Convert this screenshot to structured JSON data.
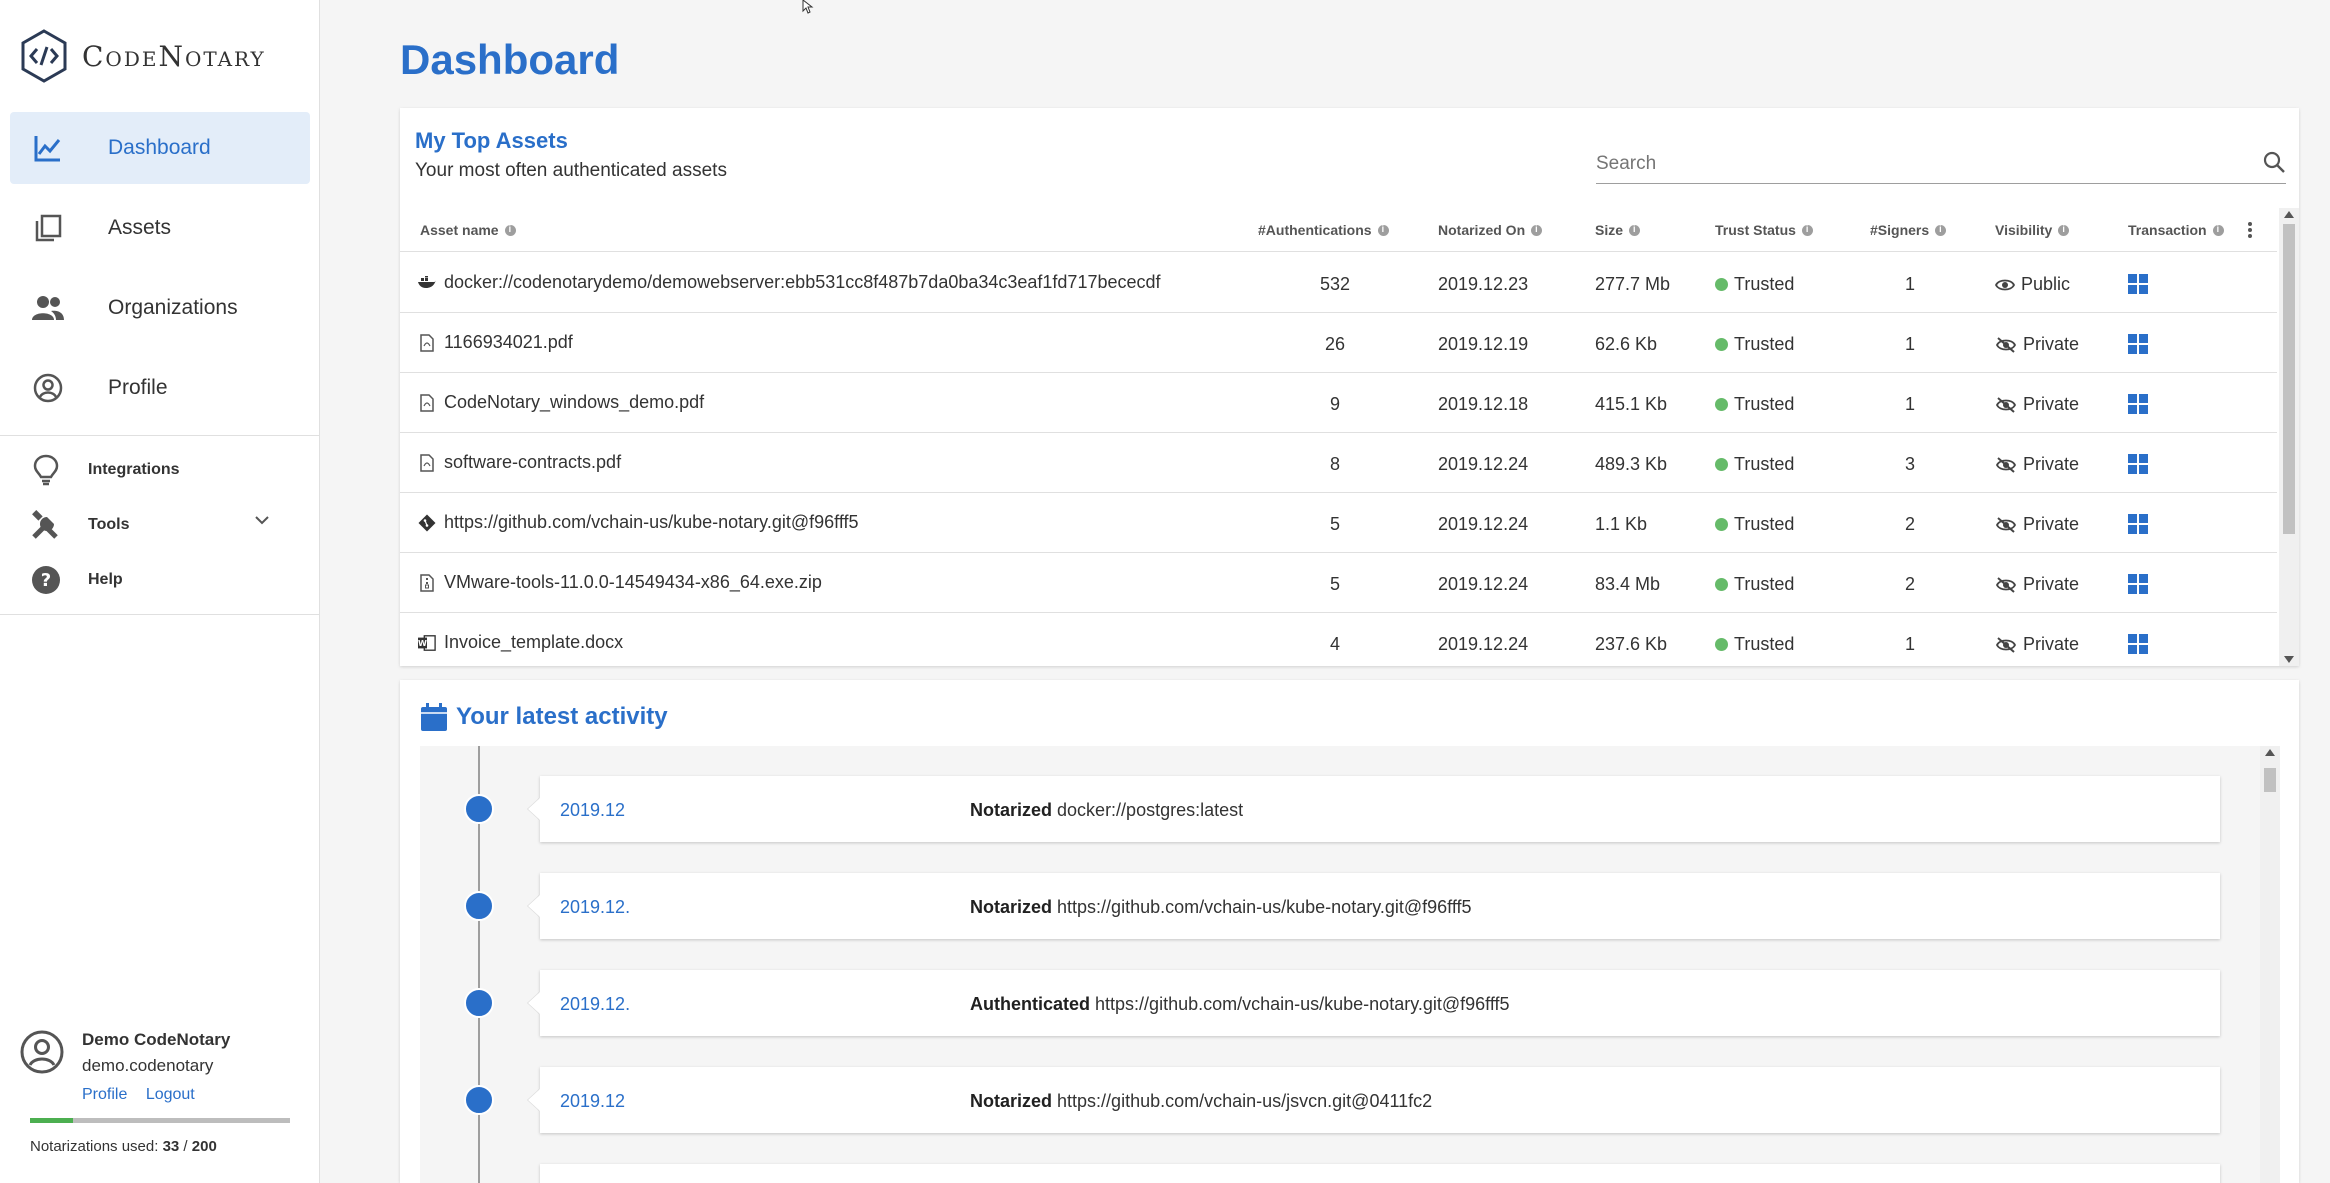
{
  "brand": {
    "name": "CodeNotary"
  },
  "nav": {
    "main": [
      {
        "label": "Dashboard",
        "icon": "chart-line-icon",
        "active": true
      },
      {
        "label": "Assets",
        "icon": "copy-icon",
        "active": false
      },
      {
        "label": "Organizations",
        "icon": "people-icon",
        "active": false
      },
      {
        "label": "Profile",
        "icon": "account-circle-icon",
        "active": false
      }
    ],
    "secondary": [
      {
        "label": "Integrations",
        "icon": "lightbulb-icon"
      },
      {
        "label": "Tools",
        "icon": "tools-icon"
      },
      {
        "label": "Help",
        "icon": "help-circle-icon"
      }
    ]
  },
  "user": {
    "name": "Demo CodeNotary",
    "handle": "demo.codenotary",
    "profile_link": "Profile",
    "logout_link": "Logout",
    "quota_label": "Notarizations used:",
    "quota_used": "33",
    "quota_total": "200",
    "quota_fraction": 0.165
  },
  "page": {
    "title": "Dashboard"
  },
  "assets_card": {
    "title": "My Top Assets",
    "subtitle": "Your most often authenticated assets",
    "search_placeholder": "Search",
    "columns": [
      "Asset name",
      "#Authentications",
      "Notarized On",
      "Size",
      "Trust Status",
      "#Signers",
      "Visibility",
      "Transaction"
    ],
    "rows": [
      {
        "icon": "docker-icon",
        "name": "docker://codenotarydemo/demowebserver:ebb531cc8f487b7da0ba34c3eaf1fd717bececdf",
        "auths": "532",
        "date": "2019.12.23",
        "size": "277.7 Mb",
        "status": "Trusted",
        "signers": "1",
        "visibility": "Public"
      },
      {
        "icon": "pdf-file-icon",
        "name": "1166934021.pdf",
        "auths": "26",
        "date": "2019.12.19",
        "size": "62.6 Kb",
        "status": "Trusted",
        "signers": "1",
        "visibility": "Private"
      },
      {
        "icon": "pdf-file-icon",
        "name": "CodeNotary_windows_demo.pdf",
        "auths": "9",
        "date": "2019.12.18",
        "size": "415.1 Kb",
        "status": "Trusted",
        "signers": "1",
        "visibility": "Private"
      },
      {
        "icon": "pdf-file-icon",
        "name": "software-contracts.pdf",
        "auths": "8",
        "date": "2019.12.24",
        "size": "489.3 Kb",
        "status": "Trusted",
        "signers": "3",
        "visibility": "Private"
      },
      {
        "icon": "git-icon",
        "name": "https://github.com/vchain-us/kube-notary.git@f96fff5",
        "auths": "5",
        "date": "2019.12.24",
        "size": "1.1 Kb",
        "status": "Trusted",
        "signers": "2",
        "visibility": "Private"
      },
      {
        "icon": "zip-file-icon",
        "name": "VMware-tools-11.0.0-14549434-x86_64.exe.zip",
        "auths": "5",
        "date": "2019.12.24",
        "size": "83.4 Mb",
        "status": "Trusted",
        "signers": "2",
        "visibility": "Private"
      },
      {
        "icon": "word-file-icon",
        "name": "Invoice_template.docx",
        "auths": "4",
        "date": "2019.12.24",
        "size": "237.6 Kb",
        "status": "Trusted",
        "signers": "1",
        "visibility": "Private"
      }
    ]
  },
  "activity_card": {
    "title": "Your latest activity",
    "items": [
      {
        "date": "2019.12",
        "action": "Notarized",
        "target": "docker://postgres:latest"
      },
      {
        "date": "2019.12.",
        "action": "Notarized",
        "target": "https://github.com/vchain-us/kube-notary.git@f96fff5"
      },
      {
        "date": "2019.12.",
        "action": "Authenticated",
        "target": "https://github.com/vchain-us/kube-notary.git@f96fff5"
      },
      {
        "date": "2019.12",
        "action": "Notarized",
        "target": "https://github.com/vchain-us/jsvcn.git@0411fc2"
      }
    ]
  },
  "colors": {
    "accent": "#2a6fc9",
    "trusted": "#66bb6a",
    "active_bg": "#e3edf9"
  }
}
